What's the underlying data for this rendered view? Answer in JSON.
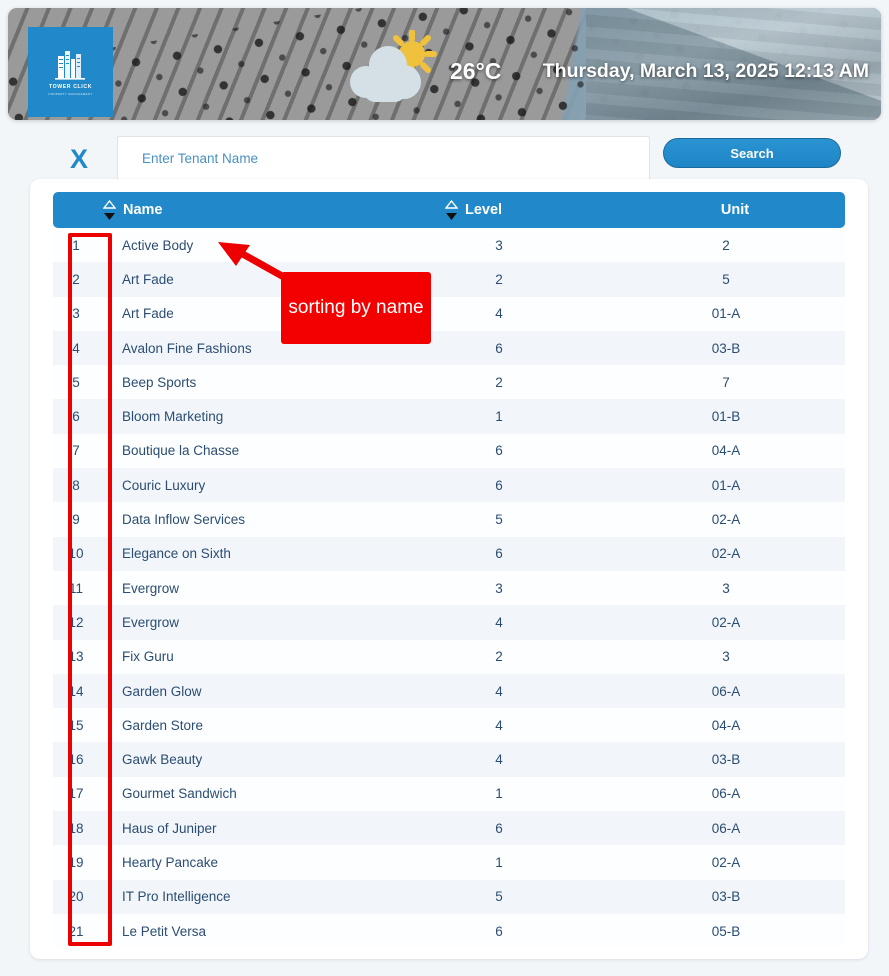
{
  "header": {
    "logo": {
      "icon": "tower-buildings-icon",
      "name": "TOWER CLICK",
      "subtitle": "PROPERTY MANAGEMENT"
    },
    "weather": {
      "icon": "partly-cloudy-sun-icon",
      "temperature": "26°C"
    },
    "datetime": "Thursday, March 13, 2025 12:13 AM"
  },
  "search": {
    "close_label": "X",
    "placeholder": "Enter Tenant Name",
    "value": "",
    "button_label": "Search"
  },
  "table": {
    "columns": [
      {
        "key": "num",
        "label": "",
        "sortable": false
      },
      {
        "key": "name",
        "label": "Name",
        "sortable": true,
        "sort_icon": "sort-asc-desc-icon"
      },
      {
        "key": "level",
        "label": "Level",
        "sortable": true,
        "sort_icon": "sort-asc-desc-icon"
      },
      {
        "key": "unit",
        "label": "Unit",
        "sortable": false
      }
    ],
    "rows": [
      {
        "num": "1",
        "name": "Active Body",
        "level": "3",
        "unit": "2"
      },
      {
        "num": "2",
        "name": "Art Fade",
        "level": "2",
        "unit": "5"
      },
      {
        "num": "3",
        "name": "Art Fade",
        "level": "4",
        "unit": "01-A"
      },
      {
        "num": "4",
        "name": "Avalon Fine Fashions",
        "level": "6",
        "unit": "03-B"
      },
      {
        "num": "5",
        "name": "Beep Sports",
        "level": "2",
        "unit": "7"
      },
      {
        "num": "6",
        "name": "Bloom Marketing",
        "level": "1",
        "unit": "01-B"
      },
      {
        "num": "7",
        "name": "Boutique la Chasse",
        "level": "6",
        "unit": "04-A"
      },
      {
        "num": "8",
        "name": "Couric Luxury",
        "level": "6",
        "unit": "01-A"
      },
      {
        "num": "9",
        "name": "Data Inflow Services",
        "level": "5",
        "unit": "02-A"
      },
      {
        "num": "10",
        "name": "Elegance on Sixth",
        "level": "6",
        "unit": "02-A"
      },
      {
        "num": "11",
        "name": "Evergrow",
        "level": "3",
        "unit": "3"
      },
      {
        "num": "12",
        "name": "Evergrow",
        "level": "4",
        "unit": "02-A"
      },
      {
        "num": "13",
        "name": "Fix Guru",
        "level": "2",
        "unit": "3"
      },
      {
        "num": "14",
        "name": "Garden Glow",
        "level": "4",
        "unit": "06-A"
      },
      {
        "num": "15",
        "name": "Garden Store",
        "level": "4",
        "unit": "04-A"
      },
      {
        "num": "16",
        "name": "Gawk Beauty",
        "level": "4",
        "unit": "03-B"
      },
      {
        "num": "17",
        "name": "Gourmet Sandwich",
        "level": "1",
        "unit": "06-A"
      },
      {
        "num": "18",
        "name": "Haus of Juniper",
        "level": "6",
        "unit": "06-A"
      },
      {
        "num": "19",
        "name": "Hearty Pancake",
        "level": "1",
        "unit": "02-A"
      },
      {
        "num": "20",
        "name": "IT Pro Intelligence",
        "level": "5",
        "unit": "03-B"
      },
      {
        "num": "21",
        "name": "Le Petit Versa",
        "level": "6",
        "unit": "05-B"
      }
    ]
  },
  "annotation": {
    "label": "sorting by name",
    "color": "#f20000"
  },
  "colors": {
    "brand_blue": "#2189c9",
    "annotation_red": "#f20000",
    "page_background": "#f2f6f9",
    "row_alt": "#f2f6fa",
    "text_blue": "#2b4d72"
  }
}
